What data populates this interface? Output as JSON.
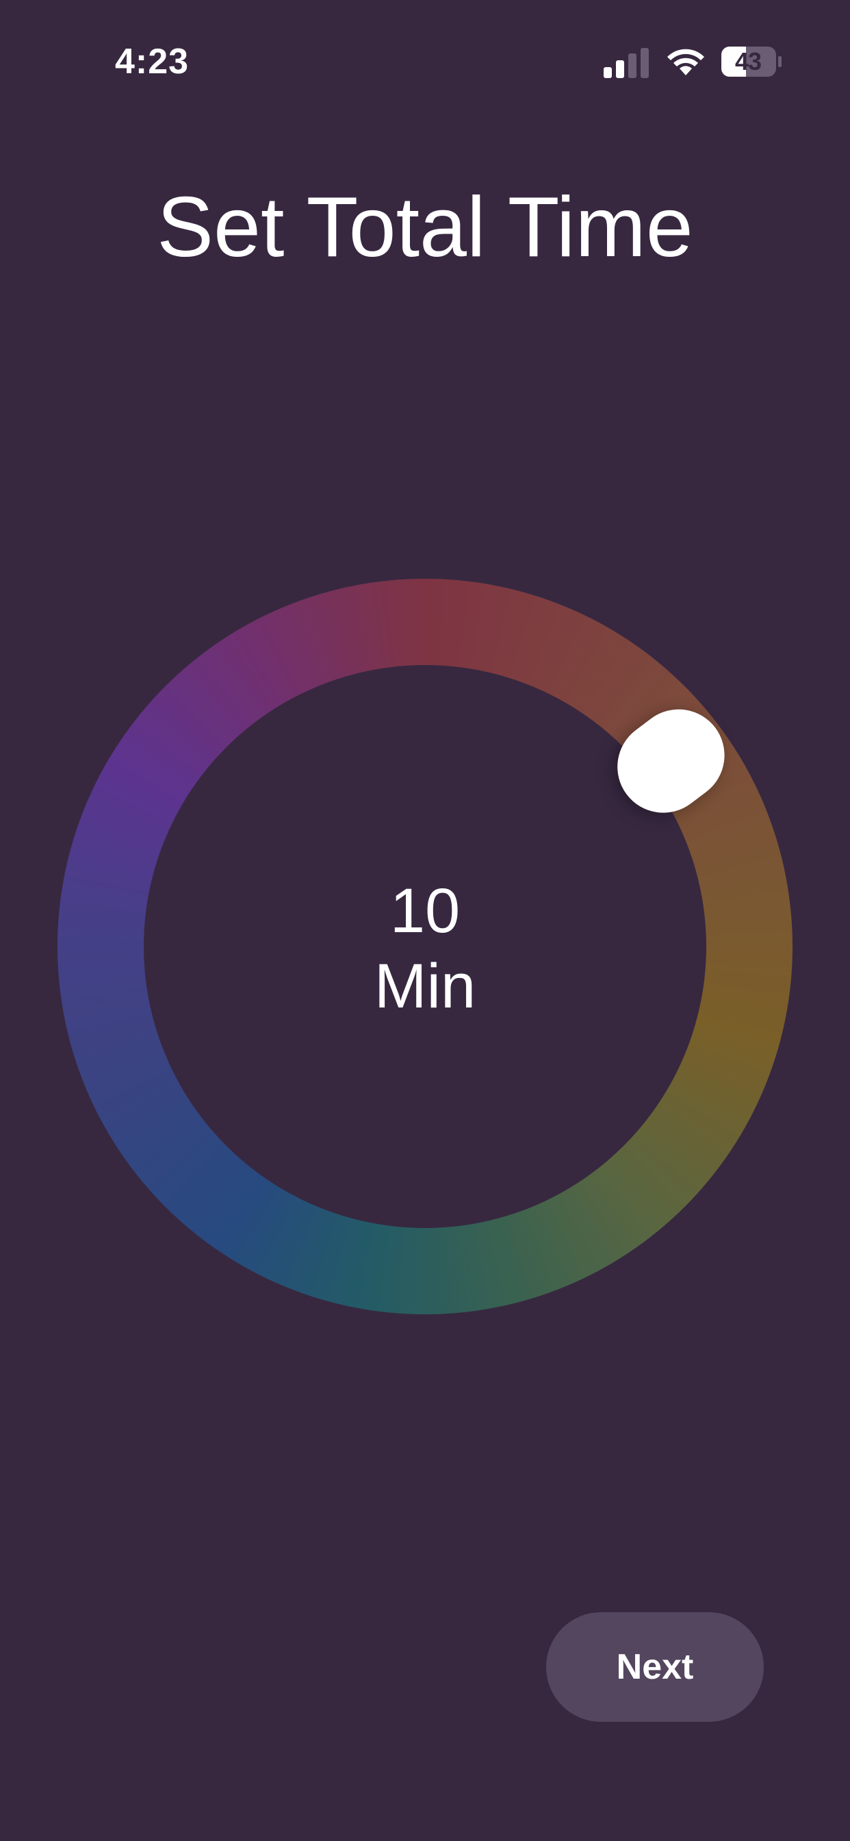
{
  "status_bar": {
    "time": "4:23",
    "battery": "43",
    "icons": [
      "signal-icon",
      "wifi-icon",
      "battery-icon"
    ]
  },
  "title": "Set Total Time",
  "dial": {
    "value": "10",
    "unit": "Min",
    "ring_colors": [
      "#7e3443",
      "#7a5f28",
      "#3a6250",
      "#274a80",
      "#5c3490"
    ],
    "knob_color": "#ffffff"
  },
  "next_button": {
    "label": "Next"
  },
  "colors": {
    "background": "#372840",
    "button_background": "#54465e"
  }
}
